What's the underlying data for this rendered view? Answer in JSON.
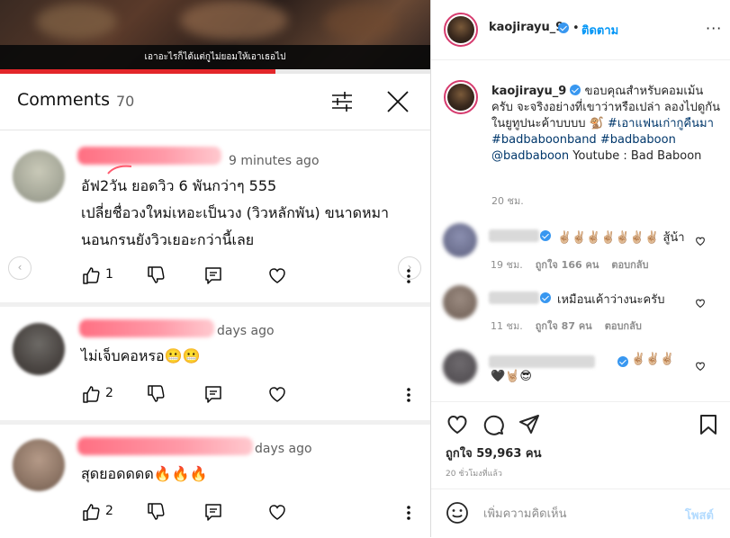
{
  "video": {
    "subtitle": "เอาอะไรก็ได้แต่กูไม่ยอมให้เอาเธอไป",
    "progress_fraction": 0.64,
    "accent": "#e3262a"
  },
  "yt_comments": {
    "title": "Comments",
    "count": "70",
    "icons": {
      "filter": "sliders-icon",
      "close": "close-icon"
    },
    "items": [
      {
        "time": "9 minutes ago",
        "lines": [
          "อัฟ2วัน ยอดวิว 6 พันกว่าๆ 555",
          "เปลี่ยชื่อวงใหม่เหอะเป็นวง (วิวหลักพัน) ขนาดหมา",
          "นอนกรนยังวิวเยอะกว่านี้เลย"
        ],
        "likes": "1"
      },
      {
        "time": "days ago",
        "lines": [
          "ไม่เจ็บคอหรอ😬😬"
        ],
        "likes": "2"
      },
      {
        "time": "days ago",
        "lines": [
          "สุดยอดดดด🔥🔥🔥"
        ],
        "likes": "2"
      }
    ]
  },
  "instagram": {
    "username": "kaojirayu_9",
    "dot": "•",
    "follow_label": "ติดตาม",
    "more_label": "···",
    "caption": {
      "username": "kaojirayu_9",
      "text": "ขอบคุณสำหรับคอมเม้นครับ จะจริงอย่างที่เขาว่าหรือเปล่า ลองไปดูกันในยูทูปนะค้าบบบบ 🐒",
      "hashtag1": "#เอาแฟนเก่ากูคืนมา",
      "hashtag2": "#badbaboonband",
      "hashtag3": "#badbaboon",
      "mention": "@badbaboon",
      "suffix": "Youtube : Bad Baboon",
      "time": "20 ชม."
    },
    "comments": [
      {
        "text": "✌🏼✌🏼✌🏼✌🏼✌🏼✌🏼✌🏼 สู้น้า",
        "time": "19 ชม.",
        "likes": "ถูกใจ 166 คน",
        "reply": "ตอบกลับ"
      },
      {
        "text": "เหมือนเค้าว่างนะครับ",
        "time": "11 ชม.",
        "likes": "ถูกใจ 87 คน",
        "reply": "ตอบกลับ"
      },
      {
        "text": "✌🏼✌🏼✌🏼",
        "text2": "🖤🤘🏼😎",
        "time": "",
        "likes": "",
        "reply": ""
      }
    ],
    "likes_text": "ถูกใจ 59,963 คน",
    "post_time": "20 ชั่วโมงที่แล้ว",
    "add_comment_placeholder": "เพิ่มความคิดเห็น",
    "post_label": "โพสต์",
    "colors": {
      "link": "#00376b",
      "follow": "#0095f6",
      "post_disabled": "#b3dbff",
      "ring": "#d63b6e"
    }
  }
}
